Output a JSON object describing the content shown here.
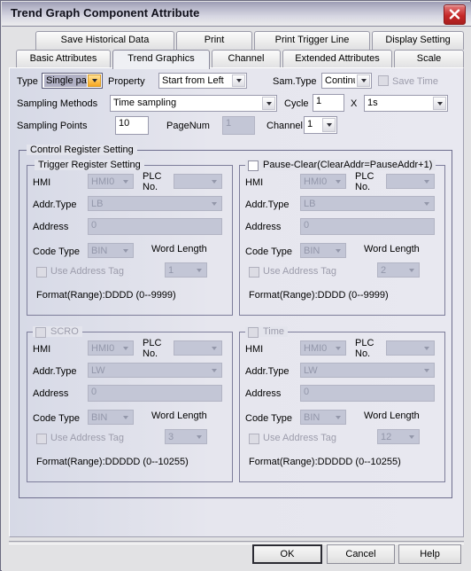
{
  "window": {
    "title": "Trend Graph Component Attribute",
    "close_icon": "close-icon"
  },
  "tabs": {
    "row1": [
      {
        "label": "Save Historical Data",
        "selected": false
      },
      {
        "label": "Print",
        "selected": false
      },
      {
        "label": "Print Trigger Line",
        "selected": false
      },
      {
        "label": "Display Setting",
        "selected": false
      }
    ],
    "row2": [
      {
        "label": "Basic Attributes",
        "selected": false
      },
      {
        "label": "Trend Graphics",
        "selected": true
      },
      {
        "label": "Channel",
        "selected": false
      },
      {
        "label": "Extended Attributes",
        "selected": false
      },
      {
        "label": "Scale",
        "selected": false
      }
    ]
  },
  "trend_graphics": {
    "type_label": "Type",
    "type_value": "Single pag",
    "property_label": "Property",
    "property_value": "Start from Left",
    "sam_type_label": "Sam.Type",
    "sam_type_value": "Continu",
    "save_time_label": "Save Time",
    "save_time_checked": false,
    "sampling_methods_label": "Sampling Methods",
    "sampling_methods_value": "Time sampling",
    "cycle_label": "Cycle",
    "cycle_value": "1",
    "multiply_symbol": "X",
    "cycle_unit_value": "1s",
    "sampling_points_label": "Sampling Points",
    "sampling_points_value": "10",
    "pagenum_label": "PageNum",
    "pagenum_value": "1",
    "channel_label": "Channel",
    "channel_value": "1"
  },
  "control_register": {
    "group_title": "Control Register Setting",
    "common": {
      "hmi_label": "HMI",
      "plc_no_label": "PLC No.",
      "addr_type_label": "Addr.Type",
      "address_label": "Address",
      "code_type_label": "Code Type",
      "word_length_label": "Word Length",
      "use_address_tag_label": "Use Address Tag"
    },
    "panels": [
      {
        "id": "trigger",
        "title": "Trigger Register Setting",
        "has_title_checkbox": false,
        "checked": false,
        "hmi_value": "HMI0",
        "plc_no_value": "",
        "addr_type_value": "LB",
        "address_value": "0",
        "code_type_value": "BIN",
        "word_length_value": "1",
        "use_address_tag_checked": false,
        "format_text": "Format(Range):DDDD (0--9999)"
      },
      {
        "id": "pause-clear",
        "title": "Pause-Clear(ClearAddr=PauseAddr+1)",
        "has_title_checkbox": true,
        "checked": false,
        "hmi_value": "HMI0",
        "plc_no_value": "",
        "addr_type_value": "LB",
        "address_value": "0",
        "code_type_value": "BIN",
        "word_length_value": "2",
        "use_address_tag_checked": false,
        "format_text": "Format(Range):DDDD (0--9999)"
      },
      {
        "id": "scro",
        "title": "SCRO",
        "has_title_checkbox": true,
        "checked": false,
        "hmi_value": "HMI0",
        "plc_no_value": "",
        "addr_type_value": "LW",
        "address_value": "0",
        "code_type_value": "BIN",
        "word_length_value": "3",
        "use_address_tag_checked": false,
        "format_text": "Format(Range):DDDDD (0--10255)"
      },
      {
        "id": "time",
        "title": "Time",
        "has_title_checkbox": true,
        "checked": false,
        "hmi_value": "HMI0",
        "plc_no_value": "",
        "addr_type_value": "LW",
        "address_value": "0",
        "code_type_value": "BIN",
        "word_length_value": "12",
        "use_address_tag_checked": false,
        "format_text": "Format(Range):DDDDD (0--10255)"
      }
    ]
  },
  "footer": {
    "ok_label": "OK",
    "cancel_label": "Cancel",
    "help_label": "Help"
  },
  "colors": {
    "titlebar_start": "#9c9cb4",
    "titlebar_end": "#ececed",
    "close_red": "#c62828",
    "focus_amber": "#f5a623",
    "disabled_bg": "#c3c6d6",
    "disabled_text": "#9397aa",
    "panel_bg": "#e6e6ee"
  }
}
